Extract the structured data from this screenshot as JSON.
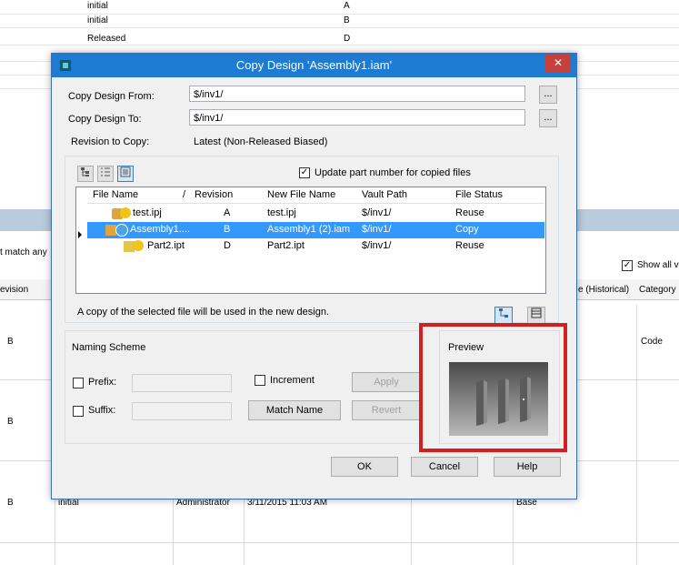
{
  "background": {
    "rows": [
      {
        "state": "initial",
        "rev": "A"
      },
      {
        "state": "initial",
        "rev": "B"
      },
      {
        "state": "Released",
        "rev": "D"
      }
    ],
    "match_any": "t match any",
    "show_all": "Show all v",
    "col_revision": "evision",
    "col_historical": "e (Historical)",
    "col_category": "Category",
    "rev_values": [
      "B",
      "B",
      "B"
    ],
    "code": "Code",
    "bottom_cells": [
      "initial",
      "Administrator",
      "3/11/2015 11:03 AM",
      "Base"
    ]
  },
  "dialog": {
    "title": "Copy Design 'Assembly1.iam'",
    "close": "✕",
    "from_label": "Copy Design From:",
    "from_value": "$/inv1/",
    "to_label": "Copy Design To:",
    "to_value": "$/inv1/",
    "browse": "...",
    "rev_label": "Revision to Copy:",
    "rev_value": "Latest (Non-Released Biased)",
    "update_part": "Update part number for copied files",
    "headers": {
      "file_name": "File Name",
      "sort": "/",
      "revision": "Revision",
      "new_file_name": "New File Name",
      "vault_path": "Vault Path",
      "file_status": "File Status"
    },
    "files": [
      {
        "name": "test.ipj",
        "revision": "A",
        "new_name": "test.ipj",
        "path": "$/inv1/",
        "status": "Reuse"
      },
      {
        "name": "Assembly1....",
        "revision": "B",
        "new_name": "Assembly1 (2).iam",
        "path": "$/inv1/",
        "status": "Copy"
      },
      {
        "name": "Part2.ipt",
        "revision": "D",
        "new_name": "Part2.ipt",
        "path": "$/inv1/",
        "status": "Reuse"
      }
    ],
    "info_text": "A copy of the selected file will be used in the new design.",
    "naming_scheme": "Naming Scheme",
    "prefix": "Prefix:",
    "suffix": "Suffix:",
    "increment": "Increment",
    "apply": "Apply",
    "match_name": "Match Name",
    "revert": "Revert",
    "preview": "Preview",
    "ok": "OK",
    "cancel": "Cancel",
    "help": "Help"
  },
  "colors": {
    "title_bar": "#1d7bd1",
    "selection": "#3399ff",
    "highlight": "#d31f1f"
  }
}
